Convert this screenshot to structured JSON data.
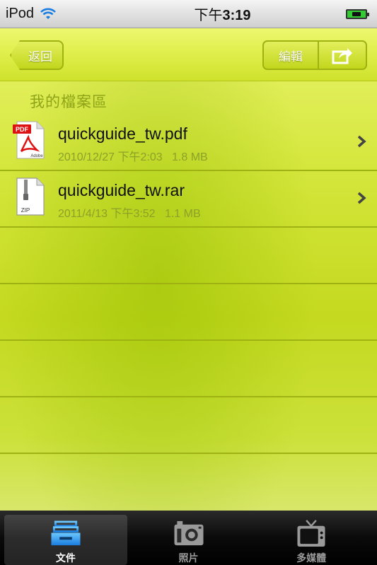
{
  "status_bar": {
    "carrier": "iPod",
    "time_ampm": "下午",
    "time": "3:19"
  },
  "nav": {
    "back_label": "返回",
    "edit_label": "編輯"
  },
  "section": {
    "title": "我的檔案區"
  },
  "files": [
    {
      "name": "quickguide_tw.pdf",
      "date": "2010/12/27 下午2:03",
      "size": "1.8 MB",
      "icon": "pdf-file-icon"
    },
    {
      "name": "quickguide_tw.rar",
      "date": "2011/4/13 下午3:52",
      "size": "1.1 MB",
      "icon": "zip-file-icon"
    }
  ],
  "tabs": [
    {
      "label": "文件",
      "icon": "documents-tray-icon",
      "active": true
    },
    {
      "label": "照片",
      "icon": "camera-icon",
      "active": false
    },
    {
      "label": "多媒體",
      "icon": "tv-icon",
      "active": false
    }
  ],
  "colors": {
    "accent_lime": "#cfe22c",
    "row_divider": "#9fb214",
    "meta_text": "#8da028"
  }
}
